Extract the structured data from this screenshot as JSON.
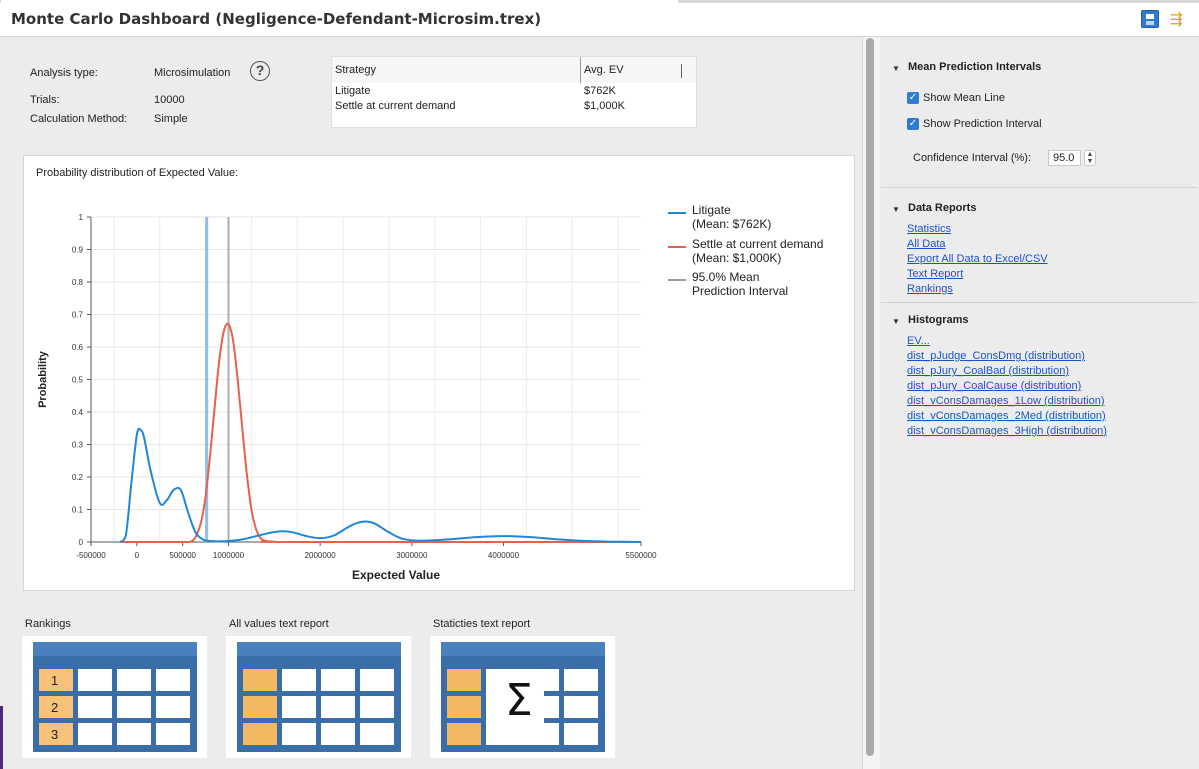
{
  "header": {
    "title": "Monte Carlo Dashboard (Negligence-Defendant-Microsim.trex)",
    "icons": [
      "save-icon",
      "layout-toggle-icon",
      "minimize-icon"
    ]
  },
  "analysis": {
    "type_label": "Analysis type:",
    "type_value": "Microsimulation",
    "trials_label": "Trials:",
    "trials_value": "10000",
    "method_label": "Calculation Method:",
    "method_value": "Simple",
    "help_glyph": "?"
  },
  "strategy_table": {
    "headers": [
      "Strategy",
      "Avg. EV"
    ],
    "rows": [
      {
        "strategy": "Litigate",
        "ev": "$762K"
      },
      {
        "strategy": "Settle at current demand",
        "ev": "$1,000K"
      }
    ]
  },
  "chart_data": {
    "type": "line",
    "title": "Probability distribution of Expected Value:",
    "xlabel": "Expected Value",
    "ylabel": "Probability",
    "xlim": [
      -500000,
      5500000
    ],
    "ylim": [
      0,
      1
    ],
    "x_ticks": [
      -500000,
      0,
      500000,
      1000000,
      2000000,
      3000000,
      4000000,
      5500000
    ],
    "x_tick_labels": [
      "-500000",
      "0",
      "500000",
      "1000000",
      "2000000",
      "3000000",
      "4000000",
      "5500000"
    ],
    "y_ticks": [
      0,
      0.1,
      0.2,
      0.3,
      0.4,
      0.5,
      0.6,
      0.7,
      0.8,
      0.9,
      1
    ],
    "y_tick_labels": [
      "0",
      "0.1",
      "0.2",
      "0.3",
      "0.4",
      "0.5",
      "0.6",
      "0.7",
      "0.8",
      "0.9",
      "1"
    ],
    "grid": true,
    "legend_position": "top-right",
    "series": [
      {
        "name": "Litigate",
        "legend_lines": [
          "Litigate",
          "(Mean: $762K)"
        ],
        "color": "#1f87d8",
        "x": [
          -180000,
          -120000,
          -60000,
          0,
          40000,
          80000,
          150000,
          250000,
          330000,
          400000,
          480000,
          560000,
          640000,
          720000,
          800000,
          900000,
          1000000,
          1150000,
          1300000,
          1450000,
          1580000,
          1700000,
          1850000,
          2000000,
          2150000,
          2300000,
          2400000,
          2500000,
          2600000,
          2750000,
          2900000,
          3100000,
          3400000,
          3700000,
          4000000,
          4300000,
          4600000,
          4900000,
          5200000,
          5500000
        ],
        "y": [
          0.0,
          0.02,
          0.18,
          0.33,
          0.345,
          0.32,
          0.22,
          0.12,
          0.13,
          0.16,
          0.16,
          0.09,
          0.03,
          0.008,
          0.003,
          0.002,
          0.003,
          0.008,
          0.018,
          0.028,
          0.033,
          0.03,
          0.018,
          0.012,
          0.02,
          0.045,
          0.058,
          0.063,
          0.056,
          0.03,
          0.01,
          0.004,
          0.008,
          0.015,
          0.018,
          0.015,
          0.008,
          0.003,
          0.001,
          0.0
        ]
      },
      {
        "name": "Settle at current demand",
        "legend_lines": [
          "Settle at current demand",
          "(Mean: $1,000K)"
        ],
        "color": "#e8604b",
        "x": [
          -180000,
          500000,
          600000,
          650000,
          700000,
          750000,
          800000,
          850000,
          900000,
          950000,
          1000000,
          1050000,
          1100000,
          1150000,
          1200000,
          1250000,
          1300000,
          1350000,
          1400000,
          1500000,
          1700000,
          5500000
        ],
        "y": [
          0,
          0,
          0.003,
          0.02,
          0.06,
          0.14,
          0.27,
          0.42,
          0.56,
          0.65,
          0.67,
          0.62,
          0.5,
          0.35,
          0.21,
          0.1,
          0.04,
          0.012,
          0.004,
          0.001,
          0,
          0
        ]
      }
    ],
    "mean_prediction_interval": {
      "legend_lines": [
        "95.0% Mean",
        "Prediction Interval"
      ],
      "color": "#9a9a9a",
      "litigate_mean": 762000,
      "settle_mean": 1000000
    }
  },
  "thumbnails": [
    {
      "label": "Rankings",
      "numbers": [
        "1",
        "2",
        "3"
      ]
    },
    {
      "label": "All values text report"
    },
    {
      "label": "Staticties text report",
      "symbol": "Σ"
    }
  ],
  "sidebar": {
    "mean_intervals": {
      "title": "Mean Prediction Intervals",
      "show_mean_line": "Show Mean Line",
      "show_prediction_interval": "Show Prediction Interval",
      "ci_label": "Confidence Interval (%):",
      "ci_value": "95.0"
    },
    "data_reports": {
      "title": "Data Reports",
      "links": [
        "Statistics",
        "All Data",
        "Export All Data to Excel/CSV",
        "Text Report",
        "Rankings"
      ]
    },
    "histograms": {
      "title": "Histograms",
      "links": [
        "EV...",
        "dist_pJudge_ConsDmg (distribution)",
        "dist_pJury_CoalBad (distribution)",
        "dist_pJury_CoalCause (distribution)",
        "dist_vConsDamages_1Low (distribution)",
        "dist_vConsDamages_2Med (distribution)",
        "dist_vConsDamages_3High (distribution)"
      ]
    }
  }
}
